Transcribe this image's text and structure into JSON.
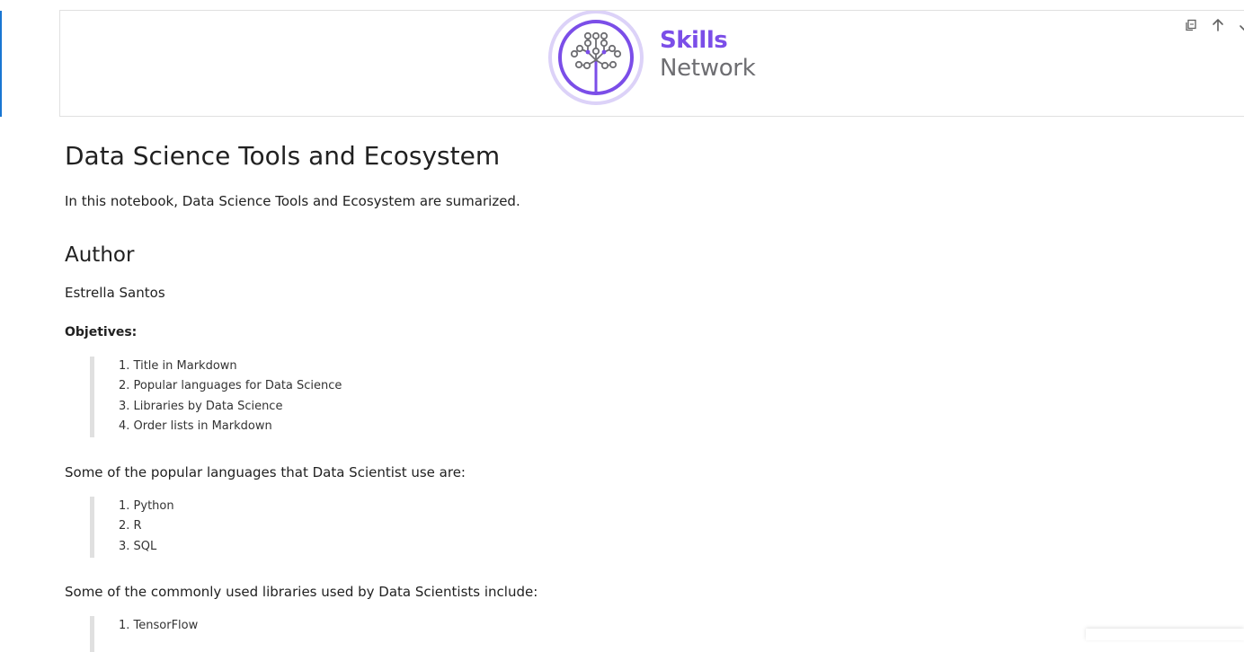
{
  "banner": {
    "logo_line1": "Skills",
    "logo_line2": "Network",
    "colors": {
      "brand_purple": "#7b4ee8",
      "brand_gray": "#6e6e72",
      "ring_light": "#dcd2f8"
    }
  },
  "toolbar": {
    "icons": [
      "duplicate-icon",
      "move-up-icon",
      "move-down-icon"
    ]
  },
  "notebook": {
    "title": "Data Science Tools and Ecosystem",
    "intro": "In this notebook, Data Science Tools and Ecosystem are sumarized.",
    "author_heading": "Author",
    "author_name": "Estrella Santos",
    "objectives_label": "Objetives:",
    "objectives": [
      "1. Title in Markdown",
      "2. Popular languages for Data Science",
      "3. Libraries by Data Science",
      "4. Order lists in Markdown"
    ],
    "languages_intro": "Some of the popular languages that Data Scientist use are:",
    "languages": [
      "1. Python",
      "2. R",
      "3. SQL"
    ],
    "libraries_intro": "Some of the commonly used libraries used by Data Scientists include:",
    "libraries": [
      "1. TensorFlow"
    ]
  },
  "colors": {
    "active_cell_bar": "#1976d2",
    "blockquote_border": "#e0e0e0"
  }
}
